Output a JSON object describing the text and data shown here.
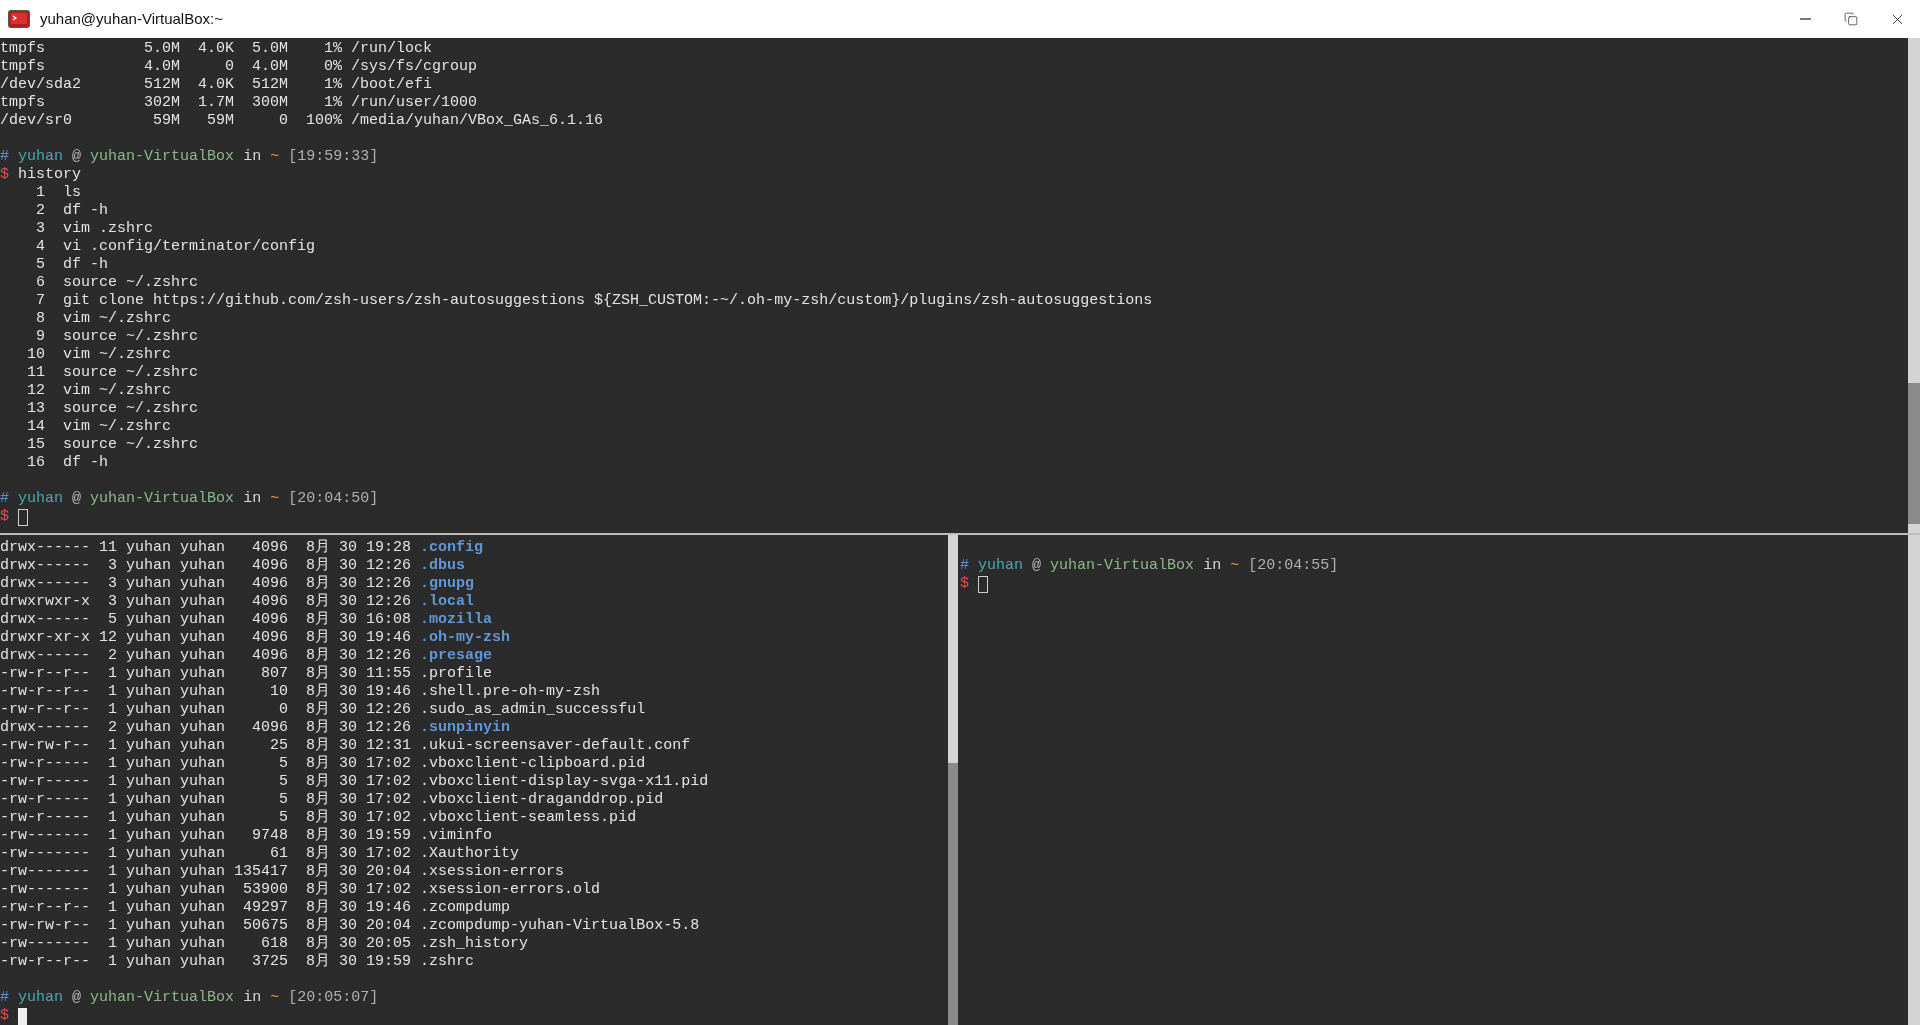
{
  "window": {
    "title": "yuhan@yuhan-VirtualBox:~"
  },
  "panes": [
    {
      "lines": [
        {
          "kind": "text",
          "text": "tmpfs           5.0M  4.0K  5.0M    1% /run/lock"
        },
        {
          "kind": "text",
          "text": "tmpfs           4.0M     0  4.0M    0% /sys/fs/cgroup"
        },
        {
          "kind": "text",
          "text": "/dev/sda2       512M  4.0K  512M    1% /boot/efi"
        },
        {
          "kind": "text",
          "text": "tmpfs           302M  1.7M  300M    1% /run/user/1000"
        },
        {
          "kind": "text",
          "text": "/dev/sr0         59M   59M     0  100% /media/yuhan/VBox_GAs_6.1.16"
        },
        {
          "kind": "blank"
        },
        {
          "kind": "prompt",
          "symbol": "#",
          "user": "yuhan",
          "at": "@",
          "host": "yuhan-VirtualBox",
          "in": "in",
          "dir": "~",
          "time": "[19:59:33]"
        },
        {
          "kind": "command",
          "symbol": "$",
          "text": "history"
        },
        {
          "kind": "text",
          "text": "    1  ls"
        },
        {
          "kind": "text",
          "text": "    2  df -h"
        },
        {
          "kind": "text",
          "text": "    3  vim .zshrc"
        },
        {
          "kind": "text",
          "text": "    4  vi .config/terminator/config"
        },
        {
          "kind": "text",
          "text": "    5  df -h"
        },
        {
          "kind": "text",
          "text": "    6  source ~/.zshrc"
        },
        {
          "kind": "text",
          "text": "    7  git clone https://github.com/zsh-users/zsh-autosuggestions ${ZSH_CUSTOM:-~/.oh-my-zsh/custom}/plugins/zsh-autosuggestions"
        },
        {
          "kind": "text",
          "text": "    8  vim ~/.zshrc"
        },
        {
          "kind": "text",
          "text": "    9  source ~/.zshrc"
        },
        {
          "kind": "text",
          "text": "   10  vim ~/.zshrc"
        },
        {
          "kind": "text",
          "text": "   11  source ~/.zshrc"
        },
        {
          "kind": "text",
          "text": "   12  vim ~/.zshrc"
        },
        {
          "kind": "text",
          "text": "   13  source ~/.zshrc"
        },
        {
          "kind": "text",
          "text": "   14  vim ~/.zshrc"
        },
        {
          "kind": "text",
          "text": "   15  source ~/.zshrc"
        },
        {
          "kind": "text",
          "text": "   16  df -h"
        },
        {
          "kind": "blank"
        },
        {
          "kind": "prompt",
          "symbol": "#",
          "user": "yuhan",
          "at": "@",
          "host": "yuhan-VirtualBox",
          "in": "in",
          "dir": "~",
          "time": "[20:04:50]"
        },
        {
          "kind": "command",
          "symbol": "$",
          "focused": false
        }
      ]
    },
    {
      "lines": [
        {
          "kind": "entry",
          "info": "drwx------ 11 yuhan yuhan   4096  8月 30 19:28",
          "name": ".config",
          "directory": true
        },
        {
          "kind": "entry",
          "info": "drwx------  3 yuhan yuhan   4096  8月 30 12:26",
          "name": ".dbus",
          "directory": true
        },
        {
          "kind": "entry",
          "info": "drwx------  3 yuhan yuhan   4096  8月 30 12:26",
          "name": ".gnupg",
          "directory": true
        },
        {
          "kind": "entry",
          "info": "drwxrwxr-x  3 yuhan yuhan   4096  8月 30 12:26",
          "name": ".local",
          "directory": true
        },
        {
          "kind": "entry",
          "info": "drwx------  5 yuhan yuhan   4096  8月 30 16:08",
          "name": ".mozilla",
          "directory": true
        },
        {
          "kind": "entry",
          "info": "drwxr-xr-x 12 yuhan yuhan   4096  8月 30 19:46",
          "name": ".oh-my-zsh",
          "directory": true
        },
        {
          "kind": "entry",
          "info": "drwx------  2 yuhan yuhan   4096  8月 30 12:26",
          "name": ".presage",
          "directory": true
        },
        {
          "kind": "entry",
          "info": "-rw-r--r--  1 yuhan yuhan    807  8月 30 11:55",
          "name": ".profile",
          "directory": false
        },
        {
          "kind": "entry",
          "info": "-rw-r--r--  1 yuhan yuhan     10  8月 30 19:46",
          "name": ".shell.pre-oh-my-zsh",
          "directory": false
        },
        {
          "kind": "entry",
          "info": "-rw-r--r--  1 yuhan yuhan      0  8月 30 12:26",
          "name": ".sudo_as_admin_successful",
          "directory": false
        },
        {
          "kind": "entry",
          "info": "drwx------  2 yuhan yuhan   4096  8月 30 12:26",
          "name": ".sunpinyin",
          "directory": true
        },
        {
          "kind": "entry",
          "info": "-rw-rw-r--  1 yuhan yuhan     25  8月 30 12:31",
          "name": ".ukui-screensaver-default.conf",
          "directory": false
        },
        {
          "kind": "entry",
          "info": "-rw-r-----  1 yuhan yuhan      5  8月 30 17:02",
          "name": ".vboxclient-clipboard.pid",
          "directory": false
        },
        {
          "kind": "entry",
          "info": "-rw-r-----  1 yuhan yuhan      5  8月 30 17:02",
          "name": ".vboxclient-display-svga-x11.pid",
          "directory": false
        },
        {
          "kind": "entry",
          "info": "-rw-r-----  1 yuhan yuhan      5  8月 30 17:02",
          "name": ".vboxclient-draganddrop.pid",
          "directory": false
        },
        {
          "kind": "entry",
          "info": "-rw-r-----  1 yuhan yuhan      5  8月 30 17:02",
          "name": ".vboxclient-seamless.pid",
          "directory": false
        },
        {
          "kind": "entry",
          "info": "-rw-------  1 yuhan yuhan   9748  8月 30 19:59",
          "name": ".viminfo",
          "directory": false
        },
        {
          "kind": "entry",
          "info": "-rw-------  1 yuhan yuhan     61  8月 30 17:02",
          "name": ".Xauthority",
          "directory": false
        },
        {
          "kind": "entry",
          "info": "-rw-------  1 yuhan yuhan 135417  8月 30 20:04",
          "name": ".xsession-errors",
          "directory": false
        },
        {
          "kind": "entry",
          "info": "-rw-------  1 yuhan yuhan  53900  8月 30 17:02",
          "name": ".xsession-errors.old",
          "directory": false
        },
        {
          "kind": "entry",
          "info": "-rw-r--r--  1 yuhan yuhan  49297  8月 30 19:46",
          "name": ".zcompdump",
          "directory": false
        },
        {
          "kind": "entry",
          "info": "-rw-rw-r--  1 yuhan yuhan  50675  8月 30 20:04",
          "name": ".zcompdump-yuhan-VirtualBox-5.8",
          "directory": false
        },
        {
          "kind": "entry",
          "info": "-rw-------  1 yuhan yuhan    618  8月 30 20:05",
          "name": ".zsh_history",
          "directory": false
        },
        {
          "kind": "entry",
          "info": "-rw-r--r--  1 yuhan yuhan   3725  8月 30 19:59",
          "name": ".zshrc",
          "directory": false
        },
        {
          "kind": "blank"
        },
        {
          "kind": "prompt",
          "symbol": "#",
          "user": "yuhan",
          "at": "@",
          "host": "yuhan-VirtualBox",
          "in": "in",
          "dir": "~",
          "time": "[20:05:07]"
        },
        {
          "kind": "command",
          "symbol": "$",
          "focused": true
        }
      ]
    },
    {
      "lines": [
        {
          "kind": "blank"
        },
        {
          "kind": "prompt",
          "symbol": "#",
          "user": "yuhan",
          "at": "@",
          "host": "yuhan-VirtualBox",
          "in": "in",
          "dir": "~",
          "time": "[20:04:55]"
        },
        {
          "kind": "command",
          "symbol": "$",
          "focused": false
        }
      ]
    }
  ]
}
